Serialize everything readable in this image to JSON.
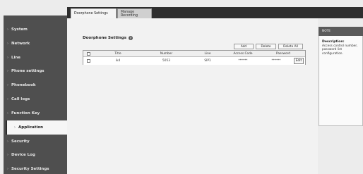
{
  "tabs": {
    "active": "Doorphone Settings",
    "inactive": "Manage Recording"
  },
  "sidebar": {
    "items": [
      {
        "label": "System"
      },
      {
        "label": "Network"
      },
      {
        "label": "Line"
      },
      {
        "label": "Phone settings"
      },
      {
        "label": "Phonebook"
      },
      {
        "label": "Call logs"
      },
      {
        "label": "Function Key"
      },
      {
        "label": "Application"
      },
      {
        "label": "Security"
      },
      {
        "label": "Device Log"
      },
      {
        "label": "Security Settings"
      }
    ],
    "active_item": "Application"
  },
  "main": {
    "title": "Doorphone Settings",
    "buttons": {
      "add": "Add",
      "delete": "Delete",
      "delete_all": "Delete All"
    },
    "table": {
      "columns": [
        "Title",
        "Number",
        "Line",
        "Access Code",
        "Password"
      ],
      "rows": [
        {
          "title": "ik4",
          "number": "5053",
          "line": "SIP1",
          "access_code": "******",
          "password": "******",
          "edit_label": "Edit"
        }
      ]
    }
  },
  "note": {
    "header": "NOTE",
    "label": "Description:",
    "text": "Access control number, password list configuration."
  }
}
